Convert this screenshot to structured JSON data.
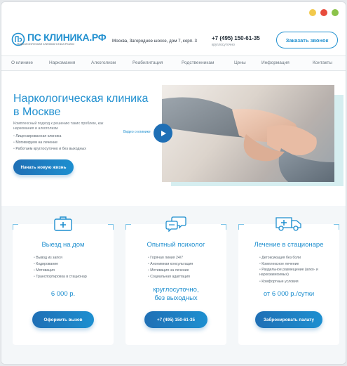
{
  "header": {
    "logo_mark": "ПС",
    "logo_text": "ПС КЛИНИКА.РФ",
    "logo_sub": "Наркологическая клиника Стаса Пьехи",
    "address": "Москва, Загородное шоссе, дом 7, корп. 3",
    "phone": "+7 (495) 150-61-35",
    "phone_sub": "круглосуточно",
    "call_button": "Заказать звонок"
  },
  "nav": [
    "О клинике",
    "Наркомания",
    "Алкоголизм",
    "Реабилитация",
    "Родственникам",
    "Цены",
    "Информация",
    "Контакты"
  ],
  "hero": {
    "title": "Наркологическая клиника в Москве",
    "subtitle": "Комплексный подход к решению таких проблем, как наркомания и алкоголизм",
    "bullets": [
      "Лицензированная клиника",
      "Мотивируем на лечение",
      "Работаем круглосуточно и без выходных"
    ],
    "button": "Начать новую жизнь",
    "video_label": "Видео о клинике"
  },
  "cards": [
    {
      "icon": "medical-kit-icon",
      "title": "Выезд на дом",
      "items": [
        "Вывод из запоя",
        "Кодирование",
        "Мотивация",
        "Транспортировка в стационар"
      ],
      "price": "6 000 р.",
      "button": "Оформить вызов"
    },
    {
      "icon": "chat-bubbles-icon",
      "title": "Опытный психолог",
      "items": [
        "Горячая линия 24/7",
        "Анонимная консультация",
        "Мотивация на лечение",
        "Социальная адаптация"
      ],
      "price": "круглосуточно, без выходных",
      "button": "+7 (495) 150-61-35"
    },
    {
      "icon": "ambulance-icon",
      "title": "Лечение в стационаре",
      "items": [
        "Детоксикация без боли",
        "Комплексное лечение",
        "Раздельное размещение (алко- и наркозависимых)",
        "Комфортные условия"
      ],
      "price": "от 6 000 р./сутки",
      "button": "Забронировать палату"
    }
  ],
  "colors": {
    "accent": "#1f8fcf",
    "button_dark": "#1f6fb5",
    "card_border": "#7ec5e8"
  }
}
